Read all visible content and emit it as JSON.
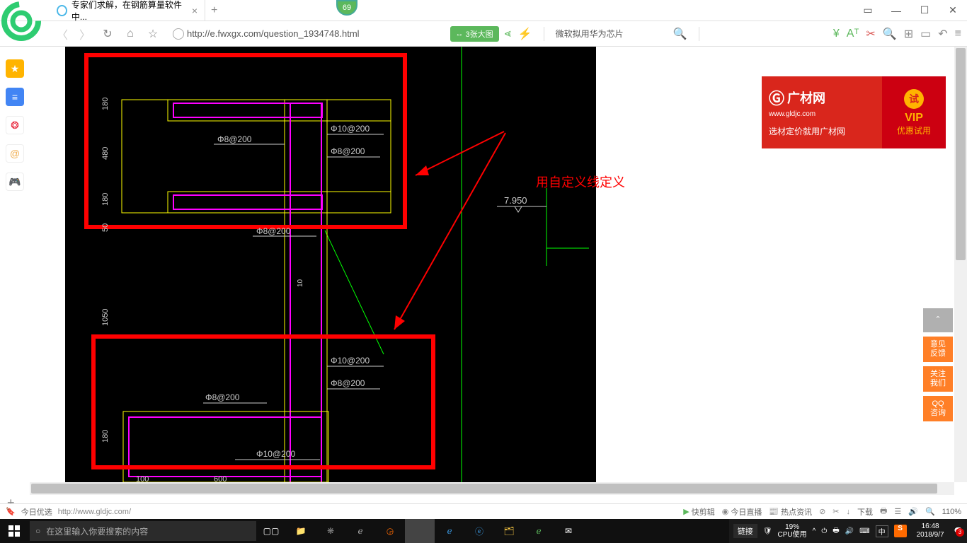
{
  "browser": {
    "tab_title": "专家们求解，在钢筋算量软件中...",
    "new_tab": "+",
    "badge": "69",
    "window_controls": {
      "box": "▭",
      "min": "—",
      "max": "☐",
      "close": "✕"
    }
  },
  "address": {
    "url": "http://e.fwxgx.com/question_1934748.html",
    "image_button": "3张大图",
    "arrow": "↔",
    "news": "微软拟用华为芯片"
  },
  "cad": {
    "annotation": "用自定义线定义",
    "labels": {
      "d180_1": "180",
      "d480": "480",
      "d180_2": "180",
      "d50": "50",
      "d1050": "1050",
      "d180_3": "180",
      "d100": "100",
      "d600": "600",
      "d10": "10",
      "p8_200_a": "Φ8@200",
      "p10_200_a": "Φ10@200",
      "p8_200_b": "Φ8@200",
      "p8_200_c": "Φ8@200",
      "p8_200_d": "Φ8@200",
      "p10_200_b": "Φ10@200",
      "p8_200_e": "Φ8@200",
      "p10_200_c": "Φ10@200",
      "level": "7.950"
    }
  },
  "ad": {
    "logo": "广材网",
    "url": "www.gldjc.com",
    "tag": "选材定价就用广材网",
    "try": "试",
    "vip": "VIP",
    "vip_sub": "优惠试用"
  },
  "float": {
    "top": "⌃",
    "feedback": "意见\n反馈",
    "follow": "关注\n我们",
    "qq": "QQ\n咨询"
  },
  "page_status": {
    "today_pick": "今日优选",
    "hover_url": "http://www.gldjc.com/",
    "kuaijianjie": "快剪辑",
    "live": "今日直播",
    "hot": "热点资讯",
    "download": "下载",
    "zoom": "110%"
  },
  "taskbar": {
    "search_placeholder": "在这里输入你要搜索的内容",
    "link": "链接",
    "cpu_pct": "19%",
    "cpu_label": "CPU使用",
    "ime": "中",
    "s": "S",
    "time": "16:48",
    "date": "2018/9/7"
  }
}
